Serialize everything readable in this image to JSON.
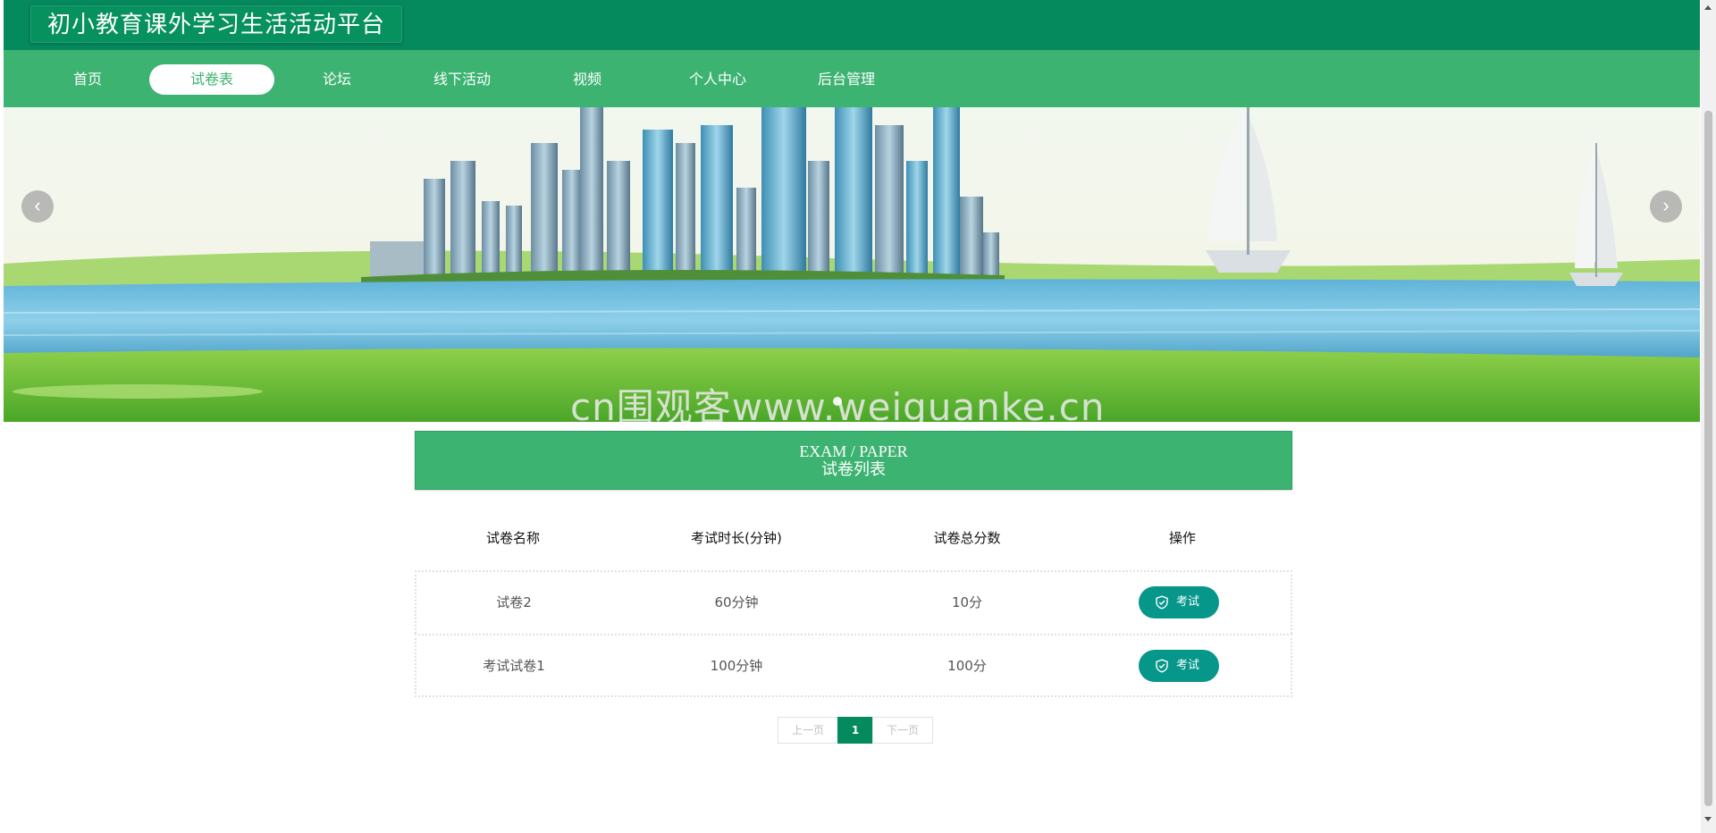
{
  "header": {
    "site_title": "初小教育课外学习生活活动平台"
  },
  "nav": {
    "items": [
      {
        "label": "首页",
        "active": false
      },
      {
        "label": "试卷表",
        "active": true
      },
      {
        "label": "论坛",
        "active": false
      },
      {
        "label": "线下活动",
        "active": false
      },
      {
        "label": "视频",
        "active": false
      },
      {
        "label": "个人中心",
        "active": false
      },
      {
        "label": "后台管理",
        "active": false
      }
    ]
  },
  "banner": {
    "prev_icon": "chevron-left-icon",
    "next_icon": "chevron-right-icon",
    "prev_glyph": "‹",
    "next_glyph": "›",
    "watermark": "cn围观客www.weiguanke.cn"
  },
  "section": {
    "title_en": "EXAM / PAPER",
    "title_zh": "试卷列表"
  },
  "table": {
    "headers": [
      "试卷名称",
      "考试时长(分钟)",
      "试卷总分数",
      "操作"
    ],
    "rows": [
      {
        "name": "试卷2",
        "duration": "60分钟",
        "score": "10分",
        "action": "考试"
      },
      {
        "name": "考试试卷1",
        "duration": "100分钟",
        "score": "100分",
        "action": "考试"
      }
    ],
    "action_icon": "shield-check-icon"
  },
  "pagination": {
    "prev": "上一页",
    "current": "1",
    "next": "下一页"
  },
  "colors": {
    "header_bg": "#058a5d",
    "nav_bg": "#3db372",
    "accent": "#06968a"
  }
}
